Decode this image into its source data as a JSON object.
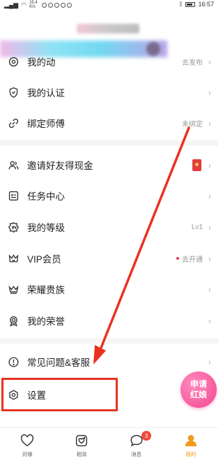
{
  "status_bar": {
    "network": "15.4 K/s",
    "time": "16:57"
  },
  "menu": {
    "items": [
      {
        "label": "我的动",
        "hint": "去发布"
      },
      {
        "label": "我的认证",
        "hint": ""
      },
      {
        "label": "绑定师傅",
        "hint": "未绑定"
      },
      {
        "label": "邀请好友得现金",
        "hint": ""
      },
      {
        "label": "任务中心",
        "hint": ""
      },
      {
        "label": "我的等级",
        "hint": "Lv1"
      },
      {
        "label": "VIP会员",
        "hint": "去开通"
      },
      {
        "label": "荣耀贵族",
        "hint": ""
      },
      {
        "label": "我的荣誉",
        "hint": ""
      },
      {
        "label": "常见问题&客服",
        "hint": ""
      },
      {
        "label": "设置",
        "hint": ""
      }
    ],
    "chevron": "›"
  },
  "fab": {
    "line1": "申请",
    "line2": "红娘"
  },
  "tabbar": {
    "tabs": [
      {
        "label": "对缘"
      },
      {
        "label": "相亲"
      },
      {
        "label": "消息",
        "badge": "3"
      },
      {
        "label": "我的"
      }
    ]
  },
  "colors": {
    "accent": "#f39a1e",
    "highlight": "#e8321f",
    "fab": "#f2468e",
    "badge": "#f04a3a"
  }
}
